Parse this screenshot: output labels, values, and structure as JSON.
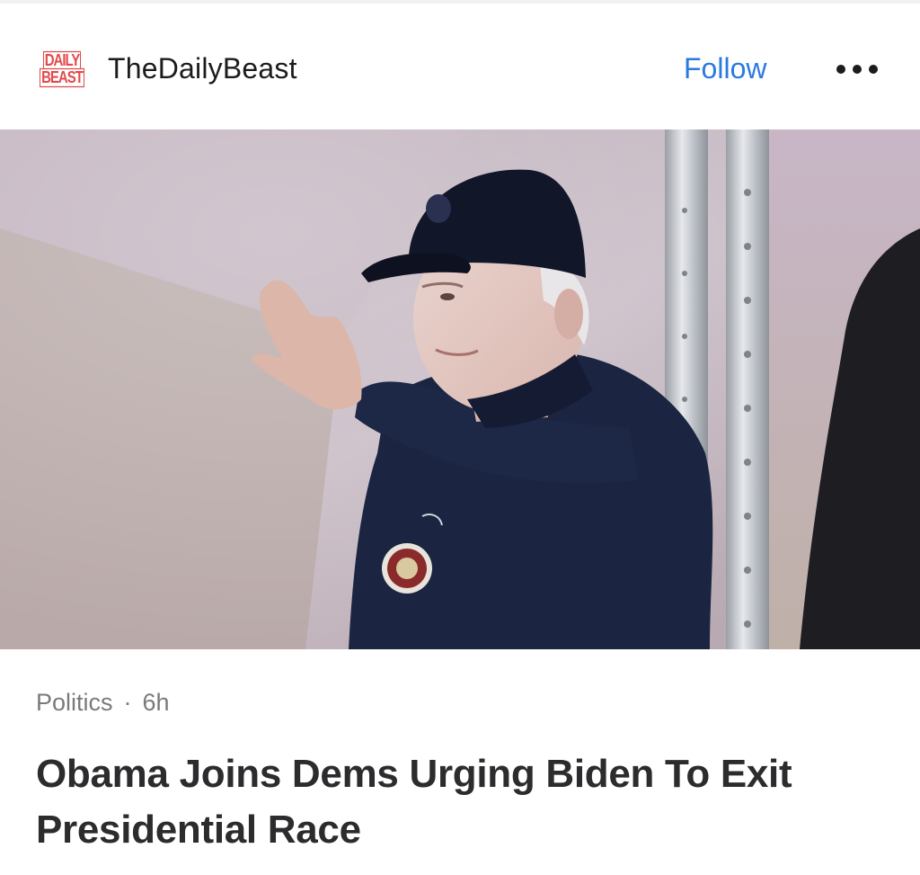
{
  "header": {
    "logo_line1": "DAILY",
    "logo_line2": "BEAST",
    "source_name": "TheDailyBeast",
    "follow_label": "Follow",
    "more_icon": "more-dots-icon"
  },
  "article": {
    "category": "Politics",
    "separator": "·",
    "age": "6h",
    "headline": "Obama Joins Dems Urging Biden To Exit Presidential Race"
  },
  "colors": {
    "accent": "#2b7ae0",
    "logo_red": "#e14b4b",
    "headline": "#2c2c2e",
    "meta": "#7a7a7e"
  }
}
